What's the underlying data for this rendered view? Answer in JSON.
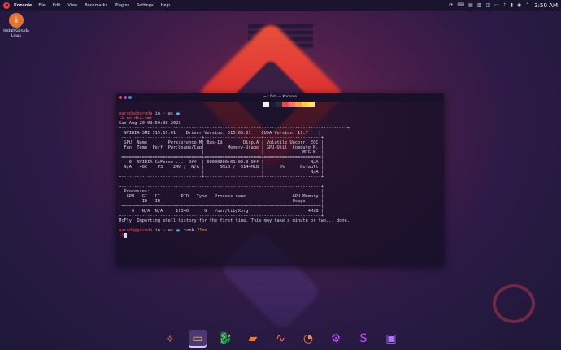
{
  "top_panel": {
    "app_name": "Konsole",
    "menu": [
      "File",
      "Edit",
      "View",
      "Bookmarks",
      "Plugins",
      "Settings",
      "Help"
    ],
    "clock": "3:50 AM",
    "tray_icons": [
      "updates-icon",
      "keyboard-icon",
      "notes-icon",
      "clipboard-icon",
      "network-icon",
      "display-icon",
      "volume-icon",
      "battery-icon",
      "notification-icon",
      "chevron-icon"
    ]
  },
  "desktop": {
    "icon_label_1": "Install Garuda",
    "icon_label_2": "Linux"
  },
  "window": {
    "title": "~ : fish — Konsole",
    "swatches": [
      "#f2f2f2",
      "#1e1e2e",
      "#2b2b3c",
      "#e8484e",
      "#ff6f6f",
      "#f4a24a",
      "#ffcf40",
      "#ffe070"
    ]
  },
  "terminal": {
    "prompt_user": "garuda@garuda",
    "prompt_in": " in ",
    "prompt_dir": "~",
    "prompt_as": " as ",
    "prompt_icon": "🐟",
    "arrow": "└λ",
    "command": " nvidia-smi",
    "lines": [
      "Sun Aug 20 03:50:38 2023",
      "+---------------------------------------------------------------------------------------+",
      "| NVIDIA-SMI 515.65.01    Driver Version: 515.65.01    CUDA Version: 11.7    |",
      "|-------------------------------+----------------------+----------------------+",
      "| GPU  Name        Persistence-M| Bus-Id        Disp.A | Volatile Uncorr. ECC |",
      "| Fan  Temp  Perf  Pwr:Usage/Cap|         Memory-Usage | GPU-Util  Compute M. |",
      "|                               |                      |               MIG M. |",
      "|===============================+======================+======================|",
      "|   0  NVIDIA GeForce ...  Off  | 00000000:01:00.0 Off |                  N/A |",
      "| N/A   48C    P3    24W /  N/A |      5MiB /  6144MiB |      0%      Default |",
      "|                               |                      |                  N/A |",
      "+-------------------------------+----------------------+----------------------+",
      "",
      "+-----------------------------------------------------------------------------+",
      "| Processes:                                                                  |",
      "|  GPU   GI   CI        PID   Type   Process name                  GPU Memory |",
      "|        ID   ID                                                   Usage      |",
      "|=============================================================================|",
      "|    0   N/A  N/A     19340      G   /usr/lib/Xorg                       4MiB |",
      "+-----------------------------------------------------------------------------+",
      "McFly: Importing shell history for the first time. This may take a minute or two... done."
    ],
    "took_label": " took ",
    "took_value": "21ms"
  },
  "dock": {
    "items": [
      {
        "name": "garuda-welcome",
        "glyph": "⟡",
        "color": "#e86a3a"
      },
      {
        "name": "konsole",
        "glyph": "▭",
        "color": "#ffb347"
      },
      {
        "name": "firedragon",
        "glyph": "🐉",
        "color": "#e8484e"
      },
      {
        "name": "file-manager",
        "glyph": "▰",
        "color": "#f07a2a"
      },
      {
        "name": "system-monitor",
        "glyph": "∿",
        "color": "#ff6060"
      },
      {
        "name": "office",
        "glyph": "◔",
        "color": "#ff8a3a"
      },
      {
        "name": "settings",
        "glyph": "⚙",
        "color": "#c34dff"
      },
      {
        "name": "store",
        "glyph": "S",
        "color": "#c34dff"
      },
      {
        "name": "package-manager",
        "glyph": "▣",
        "color": "#b070ff"
      }
    ]
  }
}
